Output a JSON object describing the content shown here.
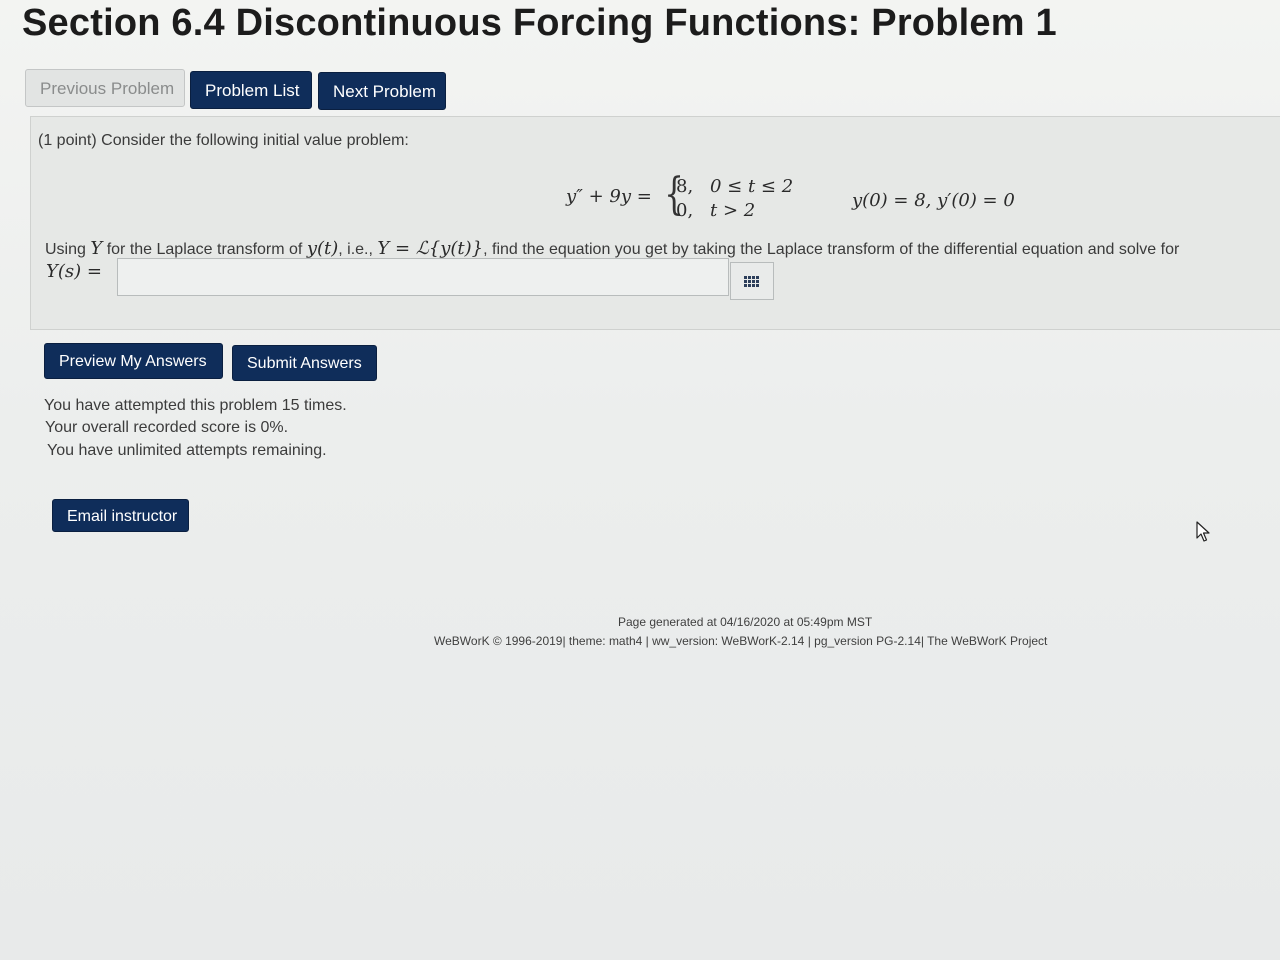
{
  "page": {
    "title": "Section 6.4 Discontinuous Forcing Functions: Problem 1"
  },
  "nav": {
    "previous": "Previous Problem",
    "list": "Problem List",
    "next": "Next Problem"
  },
  "problem": {
    "intro": "(1 point) Consider the following initial value problem:",
    "ode_lhs": "y″ + 9y =",
    "cases": [
      {
        "value": "8,",
        "condition": "0 ≤ t ≤ 2"
      },
      {
        "value": "0,",
        "condition": "t > 2"
      }
    ],
    "initial_conditions": "y(0) = 8,  y′(0) = 0",
    "instruction_prefix": "Using",
    "instruction_Y": "Y",
    "instruction_mid": "for the Laplace transform of",
    "instruction_yt": "y(t)",
    "instruction_ie": ", i.e.,",
    "instruction_eq": "Y = ℒ{y(t)}",
    "instruction_suffix": ", find the equation you get by taking the Laplace transform of the differential equation and solve for",
    "answer_label": "Y(s) =",
    "answer_value": ""
  },
  "actions": {
    "preview": "Preview My Answers",
    "submit": "Submit Answers",
    "email": "Email instructor"
  },
  "status": {
    "attempts": "You have attempted this problem 15 times.",
    "score": "Your overall recorded score is 0%.",
    "remaining": "You have unlimited attempts remaining."
  },
  "footer": {
    "generated": "Page generated at 04/16/2020 at 05:49pm MST",
    "credits": "WeBWorK © 1996-2019| theme: math4 | ww_version: WeBWorK-2.14 | pg_version PG-2.14| The WeBWorK Project"
  },
  "icons": {
    "matrix": "matrix-grid-icon",
    "cursor": "mouse-pointer-icon"
  },
  "colors": {
    "button_dark": "#0f2d5a",
    "button_disabled": "#e2e4e3",
    "problem_bg": "#e6e8e6"
  }
}
